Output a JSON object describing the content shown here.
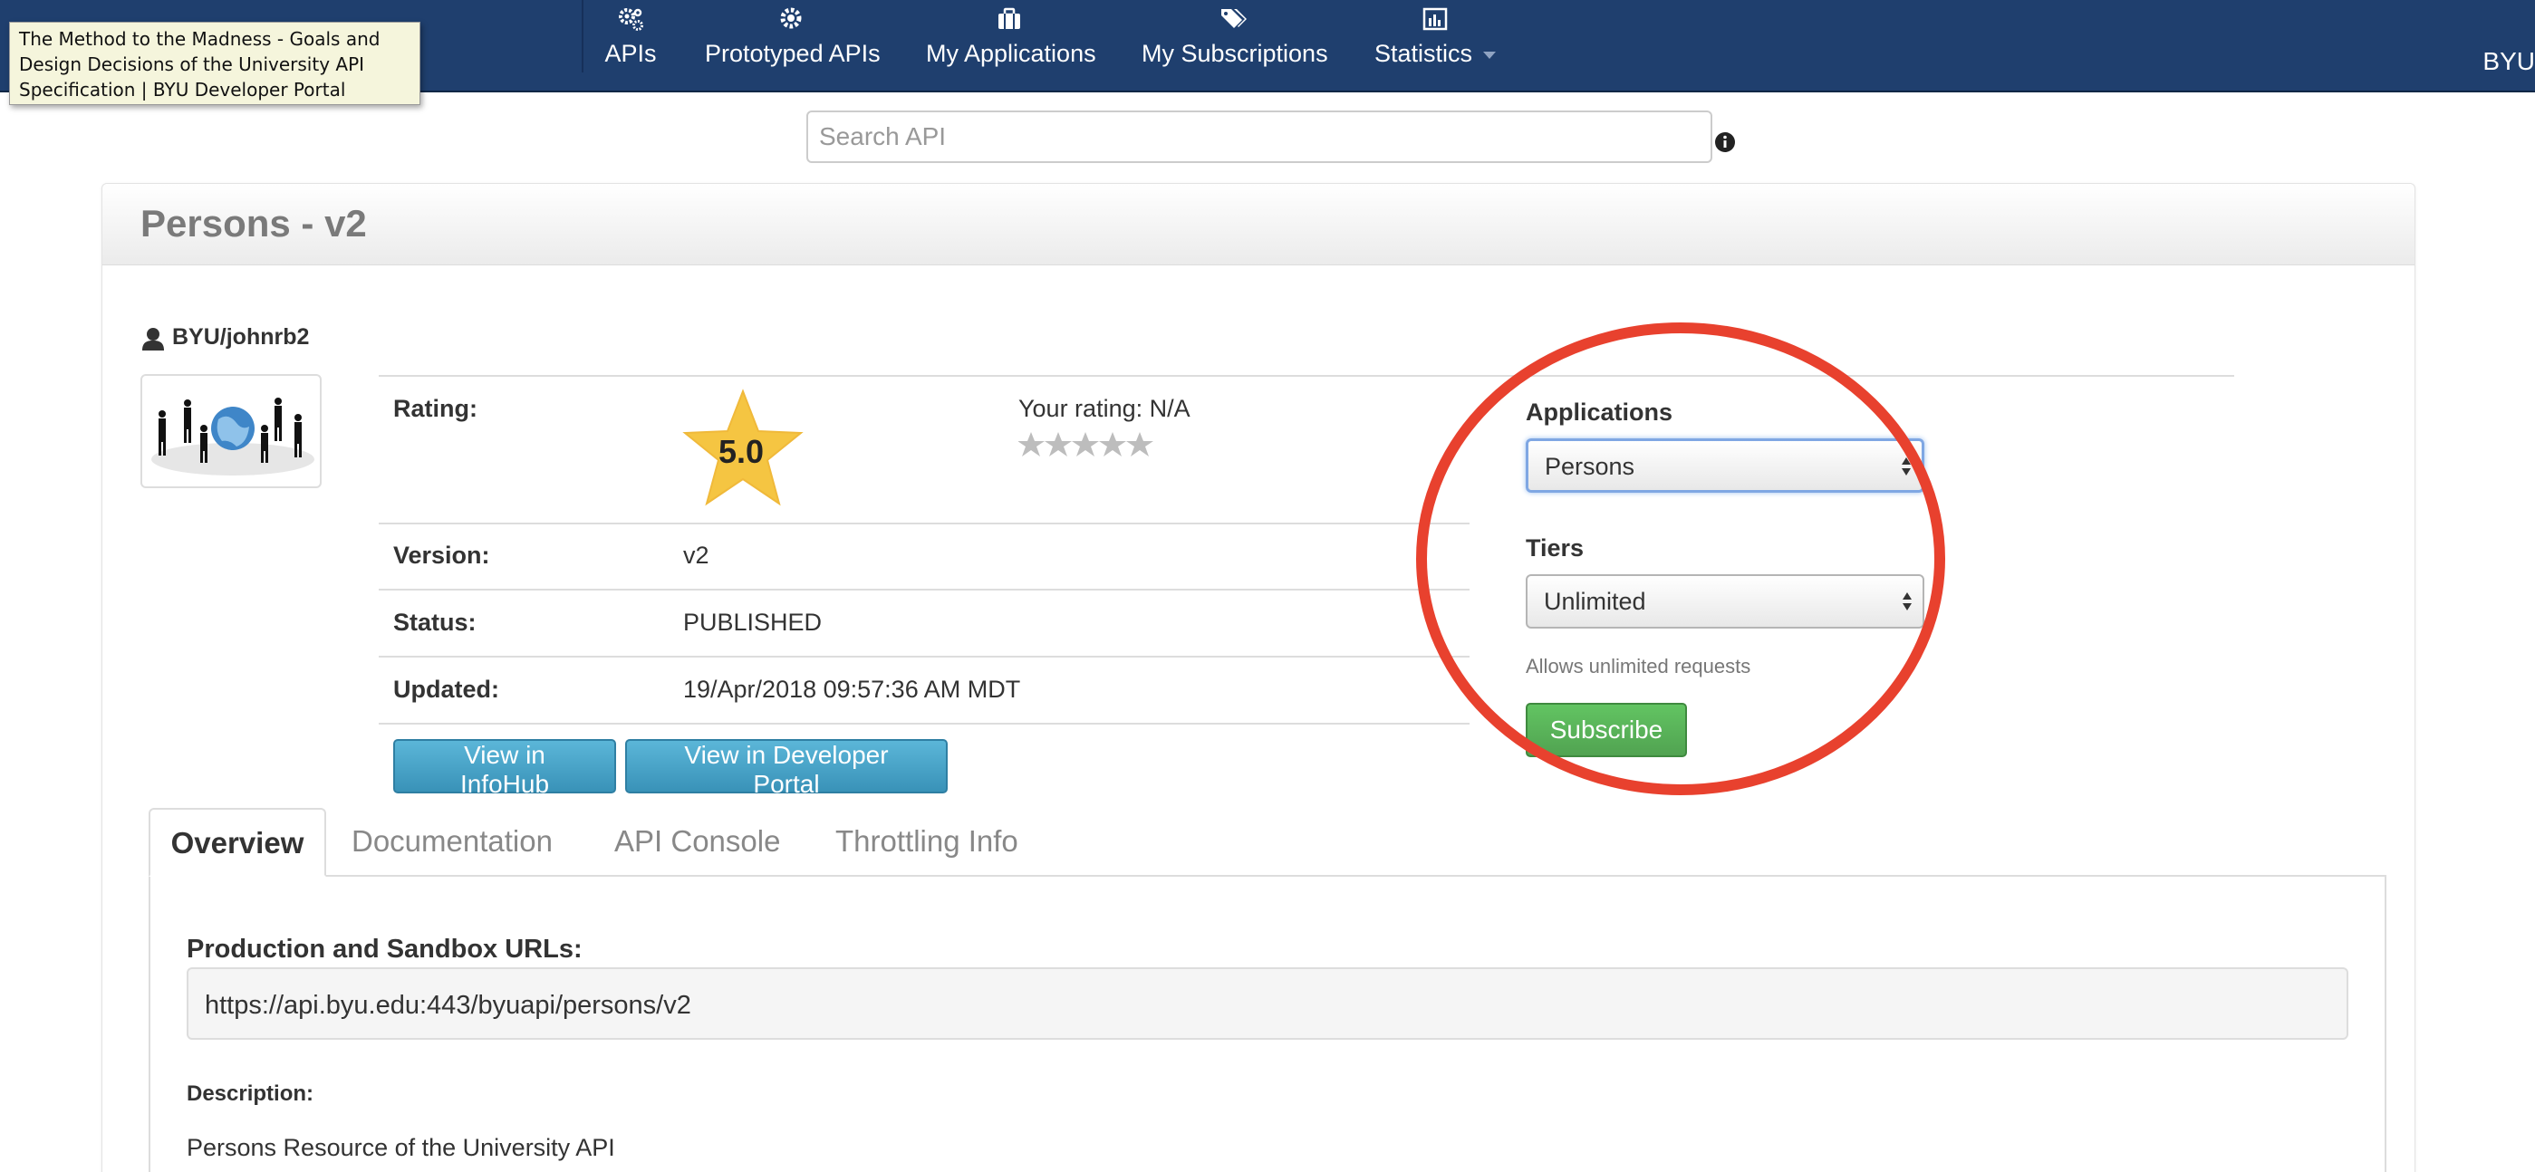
{
  "nav": {
    "items": [
      {
        "label": "APIs",
        "icon": "gears-icon"
      },
      {
        "label": "Prototyped APIs",
        "icon": "gear-icon"
      },
      {
        "label": "My Applications",
        "icon": "briefcase-icon"
      },
      {
        "label": "My Subscriptions",
        "icon": "tags-icon"
      },
      {
        "label": "Statistics",
        "icon": "bar-chart-icon"
      }
    ],
    "right_text": "BYU"
  },
  "tooltip": {
    "lines": [
      "The Method to the Madness - Goals and",
      "Design Decisions of the University API",
      "Specification | BYU Developer Portal"
    ]
  },
  "search": {
    "placeholder": "Search API"
  },
  "api": {
    "title": "Persons - v2",
    "owner": "BYU/johnrb2",
    "rating_label": "Rating:",
    "rating_value": "5.0",
    "your_rating_label": "Your rating:",
    "your_rating_value": "N/A",
    "your_rating_stars": 0,
    "version_label": "Version:",
    "version_value": "v2",
    "status_label": "Status:",
    "status_value": "PUBLISHED",
    "updated_label": "Updated:",
    "updated_value": "19/Apr/2018 09:57:36 AM MDT"
  },
  "buttons": {
    "infohub": "View in InfoHub",
    "devportal": "View in Developer Portal",
    "subscribe": "Subscribe"
  },
  "subscribe": {
    "applications_label": "Applications",
    "applications_selected": "Persons",
    "tiers_label": "Tiers",
    "tiers_selected": "Unlimited",
    "tier_hint": "Allows unlimited requests",
    "highlight_color": "#e8412e"
  },
  "tabs": [
    "Overview",
    "Documentation",
    "API Console",
    "Throttling Info"
  ],
  "overview": {
    "urls_label": "Production and Sandbox URLs:",
    "url": "https://api.byu.edu:443/byuapi/persons/v2",
    "description_label": "Description:",
    "description": "Persons Resource of the University API"
  },
  "colors": {
    "navbar": "#1f3f6e",
    "button_blue": "#3992b8",
    "button_green": "#51a351",
    "star": "#f5c542"
  }
}
